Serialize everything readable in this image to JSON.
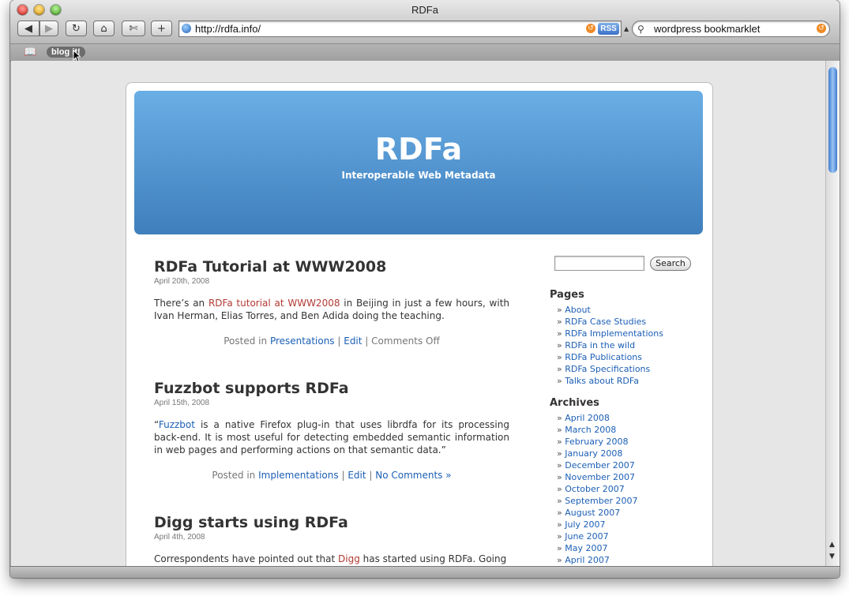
{
  "window": {
    "title": "RDFa"
  },
  "toolbar": {
    "url": "http://rdfa.info/",
    "rss_label": "RSS",
    "search_query": "wordpress bookmarklet"
  },
  "bookmarks": [
    {
      "label": "blog it!"
    }
  ],
  "site": {
    "title": "RDFa",
    "description": "Interoperable Web Metadata"
  },
  "posts": [
    {
      "title": "RDFa Tutorial at WWW2008",
      "date": "April 20th, 2008",
      "body_before": "There’s an ",
      "body_link": "RDFa tutorial at WWW2008",
      "body_after": " in Beijing in just a few hours, with Ivan Herman, Elias Torres, and Ben Adida doing the teaching.",
      "posted_in": "Posted in ",
      "category": "Presentations",
      "sep1": " | ",
      "edit": "Edit",
      "sep2": " | ",
      "comments": "Comments Off"
    },
    {
      "title": "Fuzzbot supports RDFa",
      "date": "April 15th, 2008",
      "body_before": "“",
      "body_link": "Fuzzbot",
      "body_after": " is a native Firefox plug-in that uses librdfa for its processing back-end. It is most useful for detecting embedded semantic information in web pages and performing actions on that semantic data.”",
      "posted_in": "Posted in ",
      "category": "Implementations",
      "sep1": " | ",
      "edit": "Edit",
      "sep2": " | ",
      "comments": "No Comments »"
    },
    {
      "title": "Digg starts using RDFa",
      "date": "April 4th, 2008",
      "body_before": "Correspondents have pointed out that ",
      "body_link": "Digg",
      "body_after": " has started using RDFa. Going"
    }
  ],
  "sidebar": {
    "search_button": "Search",
    "pages_heading": "Pages",
    "pages": [
      "About",
      "RDFa Case Studies",
      "RDFa Implementations",
      "RDFa in the wild",
      "RDFa Publications",
      "RDFa Specifications",
      "Talks about RDFa"
    ],
    "archives_heading": "Archives",
    "archives": [
      "April 2008",
      "March 2008",
      "February 2008",
      "January 2008",
      "December 2007",
      "November 2007",
      "October 2007",
      "September 2007",
      "August 2007",
      "July 2007",
      "June 2007",
      "May 2007",
      "April 2007"
    ]
  }
}
